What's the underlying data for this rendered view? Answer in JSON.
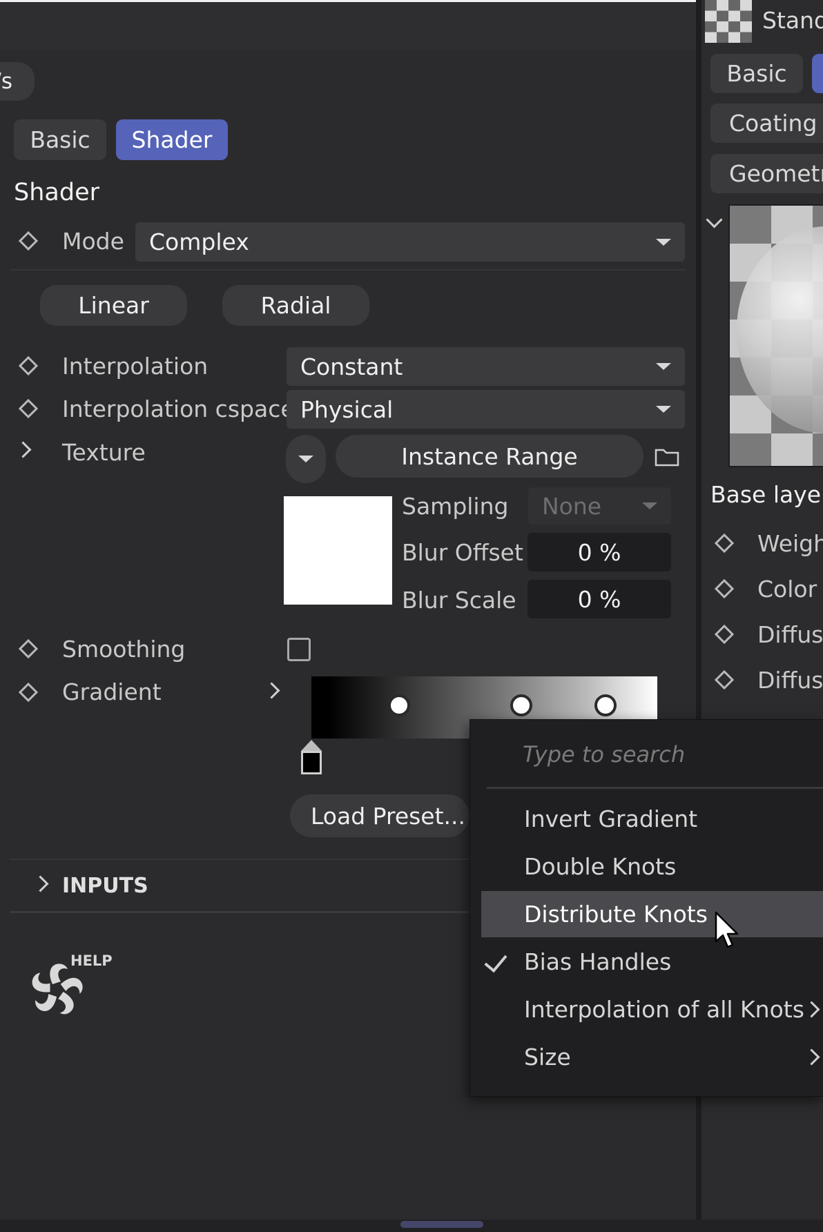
{
  "top_partial_label": "/s",
  "shader_tabs": {
    "basic": "Basic",
    "shader": "Shader"
  },
  "section_title": "Shader",
  "mode": {
    "label": "Mode",
    "value": "Complex"
  },
  "gradient_type_buttons": {
    "linear": "Linear",
    "radial": "Radial"
  },
  "interpolation": {
    "label": "Interpolation",
    "value": "Constant"
  },
  "interpolation_cspace": {
    "label": "Interpolation cspace",
    "value": "Physical"
  },
  "texture": {
    "label": "Texture",
    "instance_button": "Instance Range"
  },
  "sampling": {
    "label": "Sampling",
    "value": "None"
  },
  "blur_offset": {
    "label": "Blur Offset",
    "value": "0 %"
  },
  "blur_scale": {
    "label": "Blur Scale",
    "value": "0 %"
  },
  "smoothing": {
    "label": "Smoothing",
    "checked": false
  },
  "gradient": {
    "label": "Gradient",
    "knots": 4
  },
  "load_preset": "Load Preset...",
  "inputs_section": "INPUTS",
  "help_label": "HELP",
  "context_menu": {
    "search_placeholder": "Type to search",
    "items": [
      {
        "label": "Invert Gradient"
      },
      {
        "label": "Double Knots"
      },
      {
        "label": "Distribute Knots",
        "highlighted": true
      },
      {
        "label": "Bias Handles",
        "checked": true
      },
      {
        "label": "Interpolation of all Knots",
        "submenu": true
      },
      {
        "label": "Size",
        "submenu": true
      }
    ]
  },
  "right_panel": {
    "title_partial": "Stand",
    "tabs": [
      "Basic",
      "Coating l",
      "Geometr"
    ],
    "base_layer": "Base layer",
    "params": [
      "Weigh",
      "Color",
      "Diffuse",
      "Diffuse"
    ]
  },
  "colors": {
    "accent": "#5563b8",
    "panel_bg": "#2b2b2d",
    "menu_bg": "#1f1f21"
  }
}
